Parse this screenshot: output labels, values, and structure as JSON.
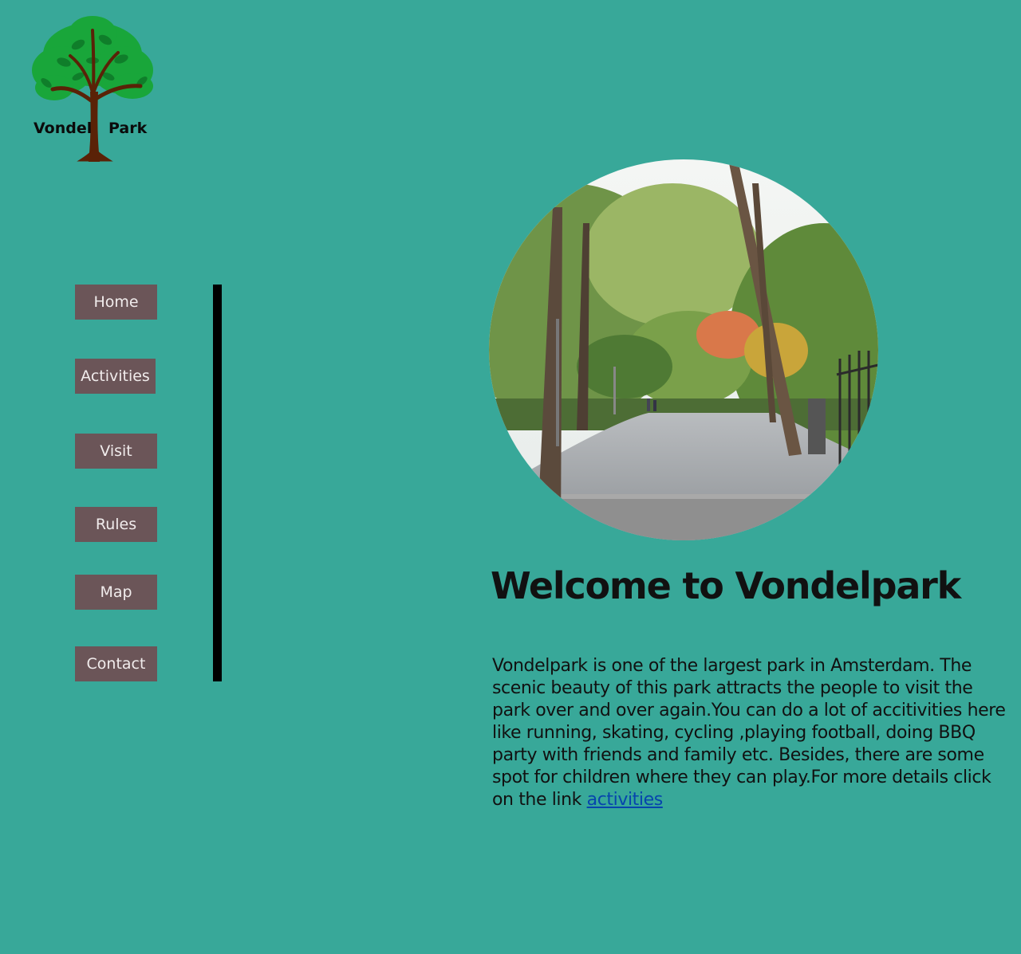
{
  "logo": {
    "word1": "Vondel",
    "word2": "Park"
  },
  "nav": {
    "items": [
      {
        "label": "Home"
      },
      {
        "label": "Activities"
      },
      {
        "label": "Visit"
      },
      {
        "label": "Rules"
      },
      {
        "label": "Map"
      },
      {
        "label": "Contact"
      }
    ]
  },
  "main": {
    "title": "Welcome to Vondelpark",
    "body": "Vondelpark is one of the largest park in Amsterdam. The scenic beauty of this park attracts the people to visit the park over and over again.You can do a lot of accitivities here like running, skating, cycling ,playing football, doing BBQ party with friends and family etc. Besides, there are some spot for children where they can play.For more details click on the link ",
    "link_text": "activities"
  },
  "colors": {
    "background": "#38a899",
    "nav_button": "#6b5558",
    "nav_text": "#f1ecec",
    "link": "#0645ad"
  }
}
